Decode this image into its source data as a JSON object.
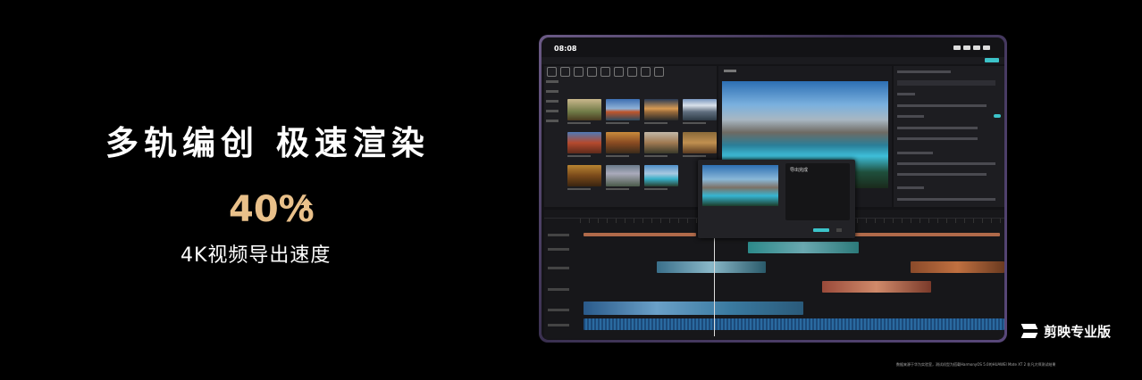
{
  "headline": "多轨编创 极速渲染",
  "stat": {
    "value": "40%",
    "arrow_icon": "up-arrow-icon",
    "caption": "4K视频导出速度"
  },
  "device": {
    "clock": "08:08",
    "dialog_title": "导出完成"
  },
  "brand": {
    "name": "剪映专业版",
    "logo_icon": "capcut-logo-icon"
  },
  "footnote": "数据来源于华为实验室，测试机型为搭载HarmonyOS 5.0的HUAWEI Mate XT 2 非凡大师测试结果",
  "colors": {
    "accent": "#e9c08a",
    "app_accent": "#3cc3c9",
    "background": "#000000"
  }
}
